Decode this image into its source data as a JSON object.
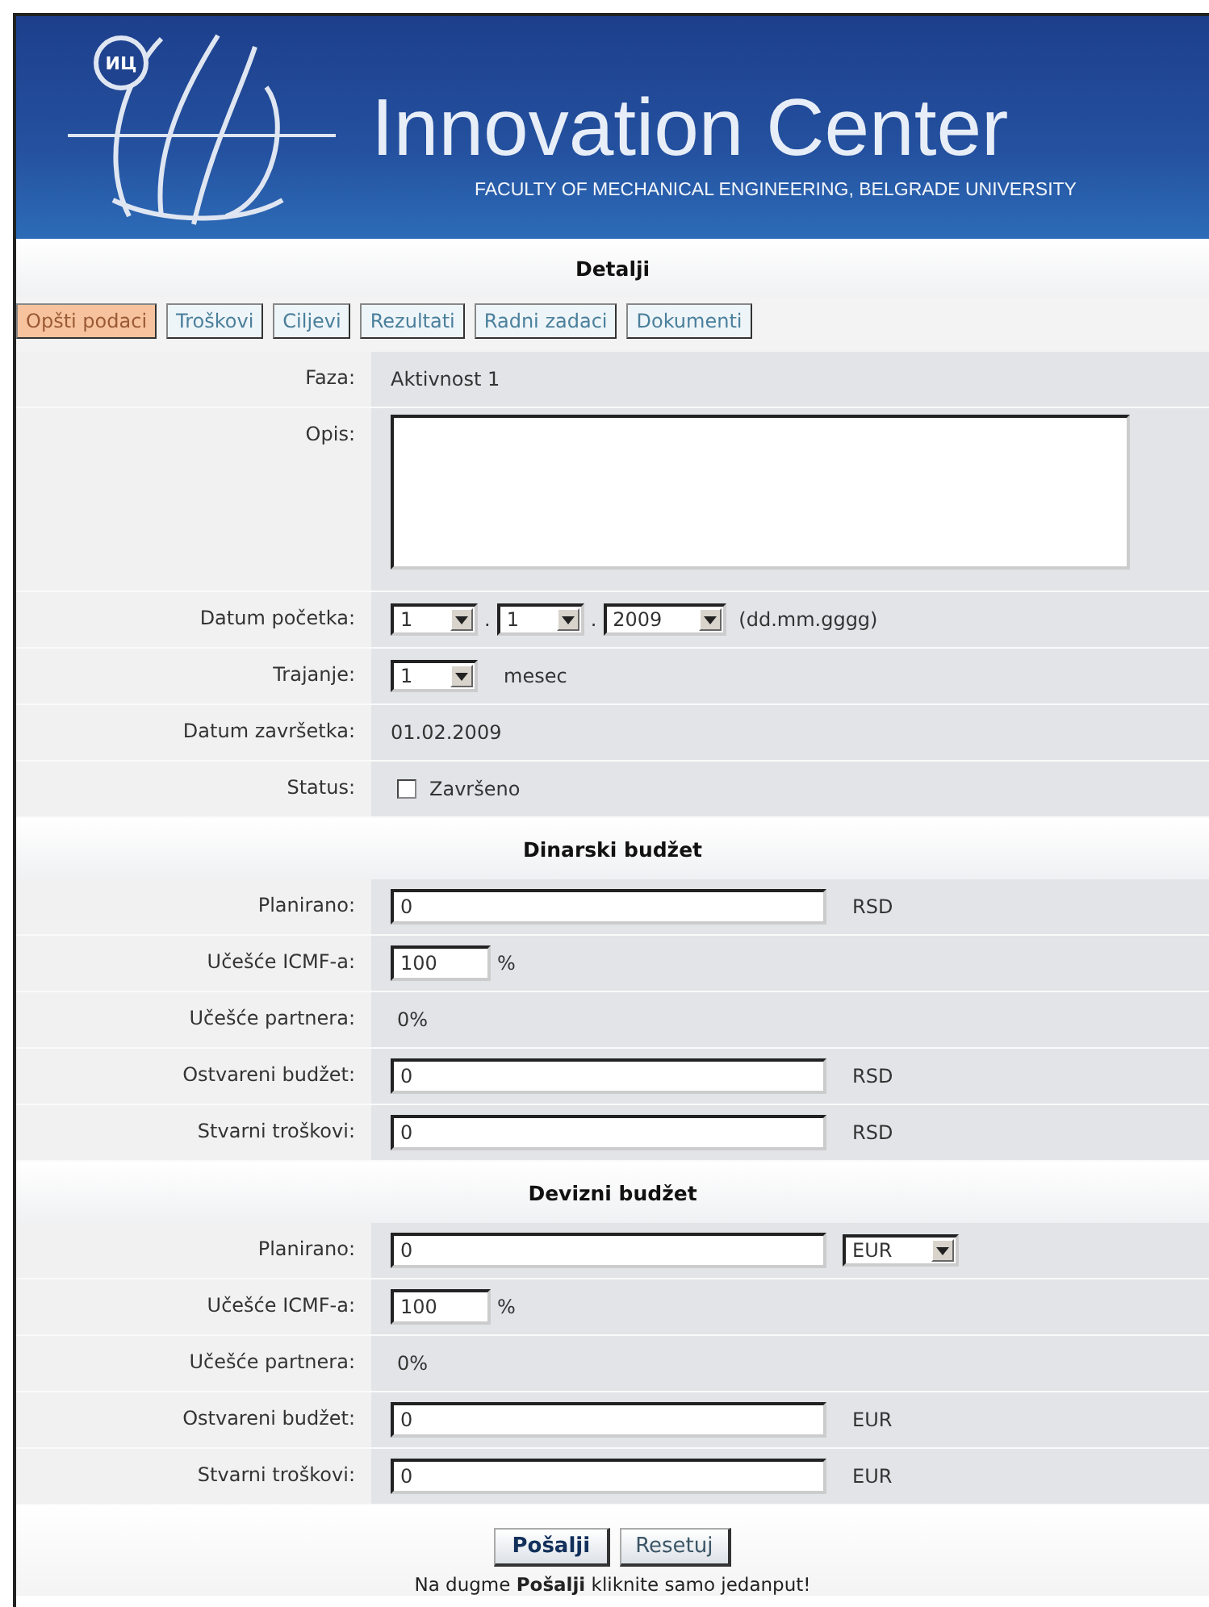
{
  "header": {
    "logo_text": "ИЦ",
    "title": "Innovation Center",
    "subtitle": "FACULTY OF MECHANICAL ENGINEERING, BELGRADE UNIVERSITY"
  },
  "section_title": "Detalji",
  "tabs": [
    {
      "label": "Opšti podaci",
      "selected": true
    },
    {
      "label": "Troškovi",
      "selected": false
    },
    {
      "label": "Ciljevi",
      "selected": false
    },
    {
      "label": "Rezultati",
      "selected": false
    },
    {
      "label": "Radni zadaci",
      "selected": false
    },
    {
      "label": "Dokumenti",
      "selected": false
    }
  ],
  "general_rows": [
    {
      "kind": "text",
      "label": "Faza:",
      "value": "Aktivnost 1"
    },
    {
      "kind": "textarea",
      "label": "Opis:"
    },
    {
      "kind": "date",
      "label": "Datum početka:",
      "day": "1",
      "month": "1",
      "year": "2009",
      "separator": ".",
      "hint": "(dd.mm.gggg)"
    },
    {
      "kind": "select",
      "label": "Trajanje:",
      "value": "1",
      "unit": "mesec"
    },
    {
      "kind": "text",
      "label": "Datum završetka:",
      "value": "01.02.2009"
    },
    {
      "kind": "checkbox",
      "label": "Status:",
      "option": "Završeno",
      "checked": false
    }
  ],
  "budgets": [
    {
      "title": "Dinarski budžet",
      "rows": [
        {
          "kind": "input",
          "label": "Planirano:",
          "value": "0",
          "unit": "RSD"
        },
        {
          "kind": "percent",
          "label": "Učešće ICMF-a:",
          "value": "100",
          "unit": "%"
        },
        {
          "kind": "text",
          "label": "Učešće partnera:",
          "value": "0%"
        },
        {
          "kind": "input",
          "label": "Ostvareni budžet:",
          "value": "0",
          "unit": "RSD"
        },
        {
          "kind": "input",
          "label": "Stvarni troškovi:",
          "value": "0",
          "unit": "RSD"
        }
      ]
    },
    {
      "title": "Devizni budžet",
      "rows": [
        {
          "kind": "input-select",
          "label": "Planirano:",
          "value": "0",
          "unit": "EUR"
        },
        {
          "kind": "percent",
          "label": "Učešće ICMF-a:",
          "value": "100",
          "unit": "%"
        },
        {
          "kind": "text",
          "label": "Učešće partnera:",
          "value": "0%"
        },
        {
          "kind": "input",
          "label": "Ostvareni budžet:",
          "value": "0",
          "unit": "EUR"
        },
        {
          "kind": "input",
          "label": "Stvarni troškovi:",
          "value": "0",
          "unit": "EUR"
        }
      ]
    }
  ],
  "buttons": [
    {
      "label": "Pošalji",
      "primary": true
    },
    {
      "label": "Resetuj",
      "primary": false
    }
  ],
  "note": "Na dugme **Pošalji** kliknite samo jedanput!"
}
